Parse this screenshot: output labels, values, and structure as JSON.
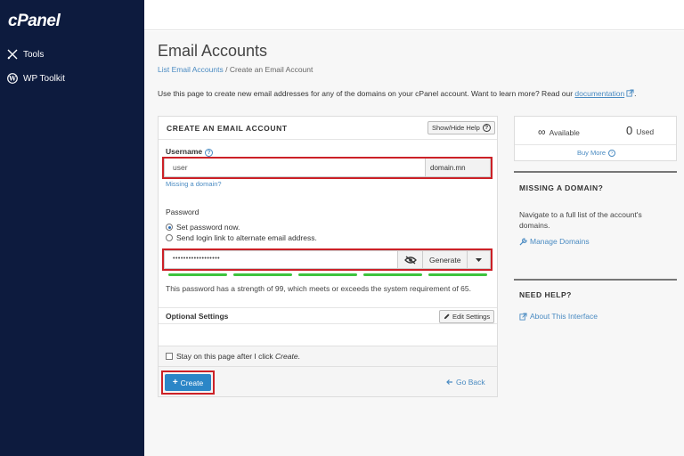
{
  "app": {
    "logo": "cPanel"
  },
  "sidebar": {
    "items": [
      {
        "label": "Tools",
        "icon": "tools-icon"
      },
      {
        "label": "WP Toolkit",
        "icon": "wordpress-icon"
      }
    ]
  },
  "page": {
    "title": "Email Accounts",
    "breadcrumb": {
      "parent": "List Email Accounts",
      "separator": "/",
      "current": "Create an Email Account"
    },
    "intro_text": "Use this page to create new email addresses for any of the domains on your cPanel account. Want to learn more? Read our",
    "intro_link": "documentation",
    "intro_end": "."
  },
  "form": {
    "title": "CREATE AN EMAIL ACCOUNT",
    "help_button": "Show/Hide Help",
    "username_label": "Username",
    "username_value": "user",
    "domain": "domain.mn",
    "missing_domain_link": "Missing a domain?",
    "password_label": "Password",
    "radio_set_now": "Set password now.",
    "radio_send_link": "Send login link to alternate email address.",
    "password_value": "••••••••••••••••••",
    "generate_button": "Generate",
    "strength_text": "This password has a strength of 99, which meets or exceeds the system requirement of 65.",
    "optional_label": "Optional Settings",
    "edit_settings_button": "Edit Settings",
    "stay_label_prefix": "Stay on this page after I click ",
    "stay_label_em": "Create",
    "stay_label_suffix": ".",
    "create_button": "Create",
    "go_back_link": "Go Back"
  },
  "stats": {
    "available_symbol": "∞",
    "available_label": "Available",
    "used_value": "0",
    "used_label": "Used",
    "buy_more": "Buy More"
  },
  "missing_domain": {
    "title": "MISSING A DOMAIN?",
    "text": "Navigate to a full list of the account's domains.",
    "link": "Manage Domains"
  },
  "need_help": {
    "title": "NEED HELP?",
    "link": "About This Interface"
  },
  "colors": {
    "sidebar_bg": "#0d1b3e",
    "accent": "#2b86c7",
    "link": "#4a8bc2",
    "highlight": "#cc2127",
    "strength": "#3ec33e"
  }
}
